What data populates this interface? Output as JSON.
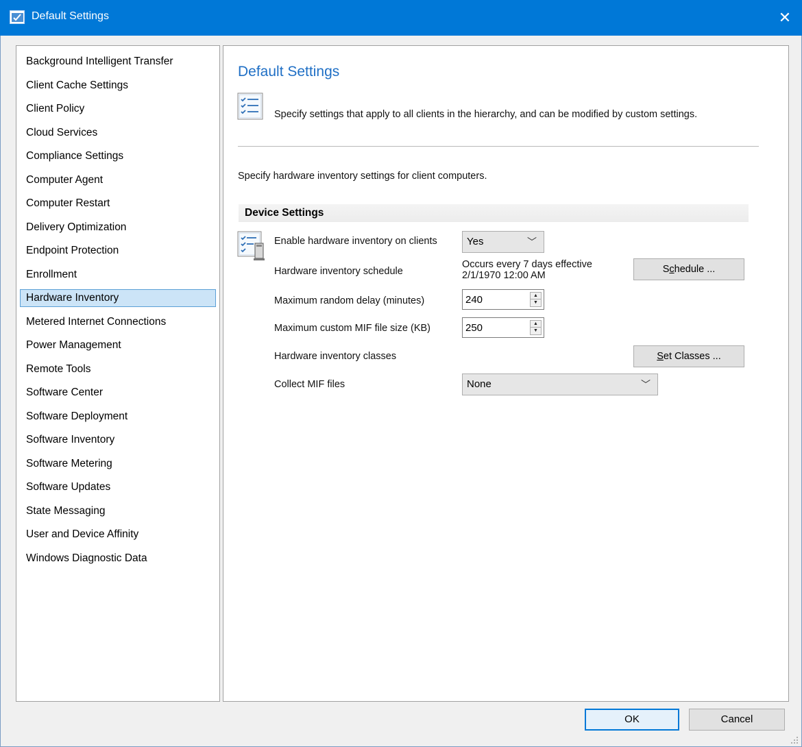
{
  "window": {
    "title": "Default Settings",
    "close_glyph": "✕"
  },
  "nav": {
    "items": [
      {
        "label": "Background Intelligent Transfer",
        "selected": false
      },
      {
        "label": "Client Cache Settings",
        "selected": false
      },
      {
        "label": "Client Policy",
        "selected": false
      },
      {
        "label": "Cloud Services",
        "selected": false
      },
      {
        "label": "Compliance Settings",
        "selected": false
      },
      {
        "label": "Computer Agent",
        "selected": false
      },
      {
        "label": "Computer Restart",
        "selected": false
      },
      {
        "label": "Delivery Optimization",
        "selected": false
      },
      {
        "label": "Endpoint Protection",
        "selected": false
      },
      {
        "label": "Enrollment",
        "selected": false
      },
      {
        "label": "Hardware Inventory",
        "selected": true
      },
      {
        "label": "Metered Internet Connections",
        "selected": false
      },
      {
        "label": "Power Management",
        "selected": false
      },
      {
        "label": "Remote Tools",
        "selected": false
      },
      {
        "label": "Software Center",
        "selected": false
      },
      {
        "label": "Software Deployment",
        "selected": false
      },
      {
        "label": "Software Inventory",
        "selected": false
      },
      {
        "label": "Software Metering",
        "selected": false
      },
      {
        "label": "Software Updates",
        "selected": false
      },
      {
        "label": "State Messaging",
        "selected": false
      },
      {
        "label": "User and Device Affinity",
        "selected": false
      },
      {
        "label": "Windows Diagnostic Data",
        "selected": false
      }
    ]
  },
  "main": {
    "title": "Default Settings",
    "description": "Specify settings that apply to all clients in the hierarchy, and can be modified by custom settings.",
    "subdescription": "Specify hardware inventory settings for client computers.",
    "group_header": "Device Settings",
    "settings": {
      "enable_label": "Enable hardware inventory on clients",
      "enable_value": "Yes",
      "schedule_label": "Hardware inventory schedule",
      "schedule_line1": "Occurs every 7 days effective",
      "schedule_line2": "2/1/1970 12:00 AM",
      "schedule_button": {
        "pre": "S",
        "accel": "c",
        "post": "hedule ..."
      },
      "delay_label": "Maximum random delay (minutes)",
      "delay_value": "240",
      "mif_size_label": "Maximum custom MIF file size (KB)",
      "mif_size_value": "250",
      "classes_label": "Hardware inventory classes",
      "classes_button": {
        "pre": "",
        "accel": "S",
        "post": "et Classes ..."
      },
      "collect_label": "Collect MIF files",
      "collect_value": "None"
    }
  },
  "footer": {
    "ok_label": "OK",
    "cancel_label": "Cancel"
  },
  "icons": {
    "window": "settings-window-icon",
    "close": "close-icon",
    "info": "checklist-icon",
    "setting": "checklist-computer-icon",
    "dropdown": "chevron-down-icon"
  },
  "colors": {
    "titlebar": "#0078d7",
    "selection": "#cce4f7",
    "selection_border": "#5a9fd6",
    "heading": "#1f6fc5"
  }
}
